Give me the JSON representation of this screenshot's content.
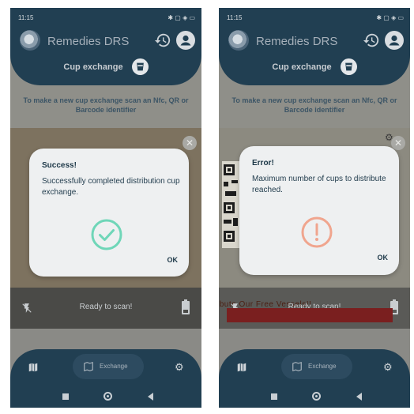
{
  "status_bar": {
    "time": "11:15",
    "left_icons": "⚙ ···",
    "right_icons": "✱ ▢ ◈ ▭"
  },
  "header": {
    "app_title": "Remedies DRS",
    "subtitle": "Cup exchange"
  },
  "instruction": "To make a new cup exchange scan an Nfc, QR or Barcode identifier",
  "scanner": {
    "ready_text": "Ready to scan!",
    "promo_text": "ibute Our Free Vessels!!"
  },
  "nav": {
    "exchange_label": "Exchange"
  },
  "dialog_success": {
    "title": "Success!",
    "message": "Successfully completed distribution cup exchange.",
    "ok_label": "OK",
    "icon": "check-circle-icon",
    "icon_color": "#6fd6b8"
  },
  "dialog_error": {
    "title": "Error!",
    "message": "Maximum number of cups to distribute reached.",
    "ok_label": "OK",
    "icon": "exclamation-circle-icon",
    "icon_color": "#f0a58e"
  },
  "colors": {
    "header": "#213f52",
    "dialog_bg": "#eef0f1",
    "text_dark": "#1c3747"
  }
}
